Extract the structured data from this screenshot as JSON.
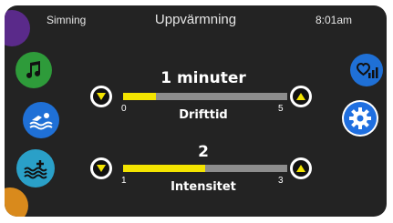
{
  "status": {
    "mode": "Simning",
    "title": "Uppvärmning",
    "time": "8:01am"
  },
  "colors": {
    "purple": "#5a2a8a",
    "green": "#2e9b3a",
    "blue": "#1f70d6",
    "teal": "#2aa0c8",
    "orange": "#d98a1c",
    "gear_blue": "#1f6fe0",
    "bar_fill": "#f3e400",
    "bar_track": "#8d8d8d"
  },
  "sidebar_left": {
    "icons": [
      "partial-purple-icon",
      "music-note-icon",
      "swimmer-icon",
      "water-heater-icon",
      "partial-orange-icon"
    ]
  },
  "sidebar_right": {
    "icons": [
      "heart-signal-icon",
      "gear-icon"
    ]
  },
  "runtime": {
    "value": "1 minuter",
    "label": "Drifttid",
    "min": "0",
    "max": "5",
    "fraction": 0.2
  },
  "intensity": {
    "value": "2",
    "label": "Intensitet",
    "min": "1",
    "max": "3",
    "fraction": 0.5
  }
}
